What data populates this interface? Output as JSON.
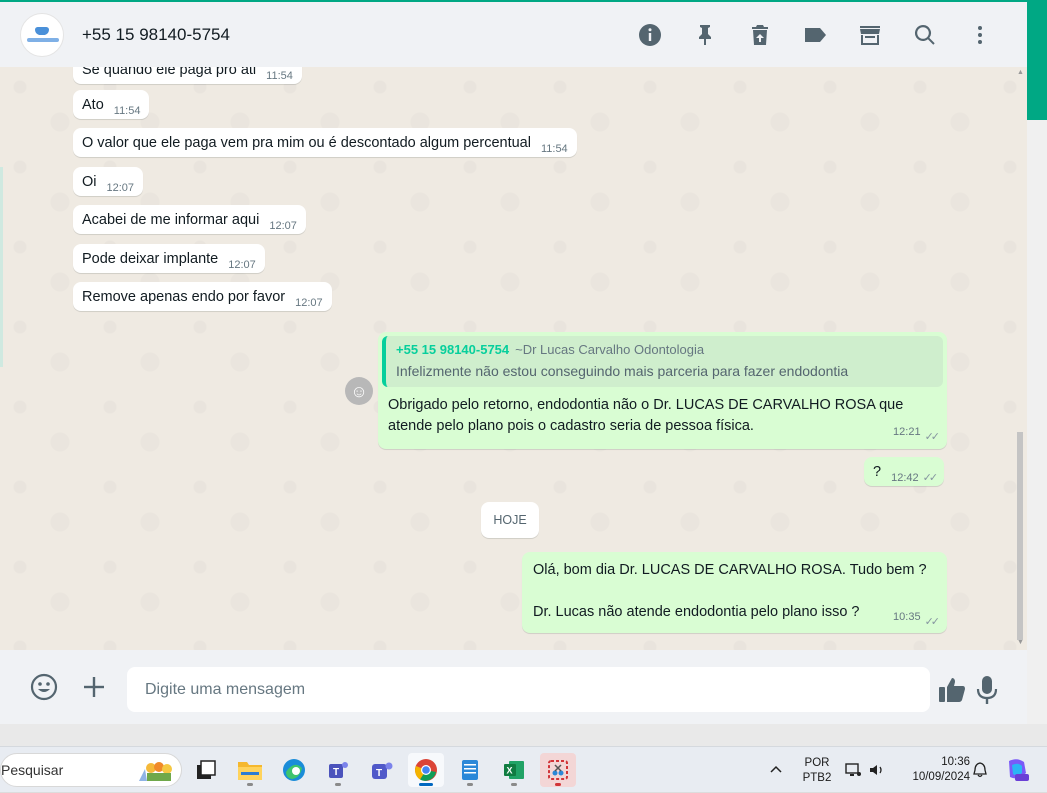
{
  "header": {
    "contact": "+55 15 98140-5754",
    "icons": [
      "info-icon",
      "pin-icon",
      "delete-icon",
      "label-icon",
      "store-icon",
      "search-icon",
      "menu-dots-icon"
    ]
  },
  "messages_in": [
    {
      "text": "Se quando ele paga pro ati",
      "time": "11:54"
    },
    {
      "text": "Ato",
      "time": "11:54"
    },
    {
      "text": "O valor que ele paga vem pra mim ou é descontado algum percentual",
      "time": "11:54"
    },
    {
      "text": "Oi",
      "time": "12:07"
    },
    {
      "text": "Acabei de me informar aqui",
      "time": "12:07"
    },
    {
      "text": "Pode deixar implante",
      "time": "12:07"
    },
    {
      "text": "Remove apenas endo por favor",
      "time": "12:07"
    }
  ],
  "reply": {
    "quote_name": "+55 15 98140-5754",
    "quote_alias": "~Dr Lucas Carvalho Odontologia",
    "quote_text": "Infelizmente não estou conseguindo mais parceria para fazer endodontia",
    "line1": "Obrigado pelo retorno, endodontia não o Dr. LUCAS DE CARVALHO ROSA que",
    "line2": "atende pelo plano pois o cadastro seria de pessoa física.",
    "time": "12:21"
  },
  "question": {
    "text": "?",
    "time": "12:42"
  },
  "day_chip": "HOJE",
  "today_msg": {
    "line1": "Olá, bom dia Dr. LUCAS DE CARVALHO ROSA. Tudo bem ?",
    "line2": "Dr. Lucas não atende endodontia pelo plano isso ?",
    "time": "10:35"
  },
  "composer": {
    "placeholder": "Digite uma mensagem"
  },
  "taskbar": {
    "search": "Pesquisar",
    "lang1": "POR",
    "lang2": "PTB2",
    "time": "10:36",
    "date": "10/09/2024"
  }
}
